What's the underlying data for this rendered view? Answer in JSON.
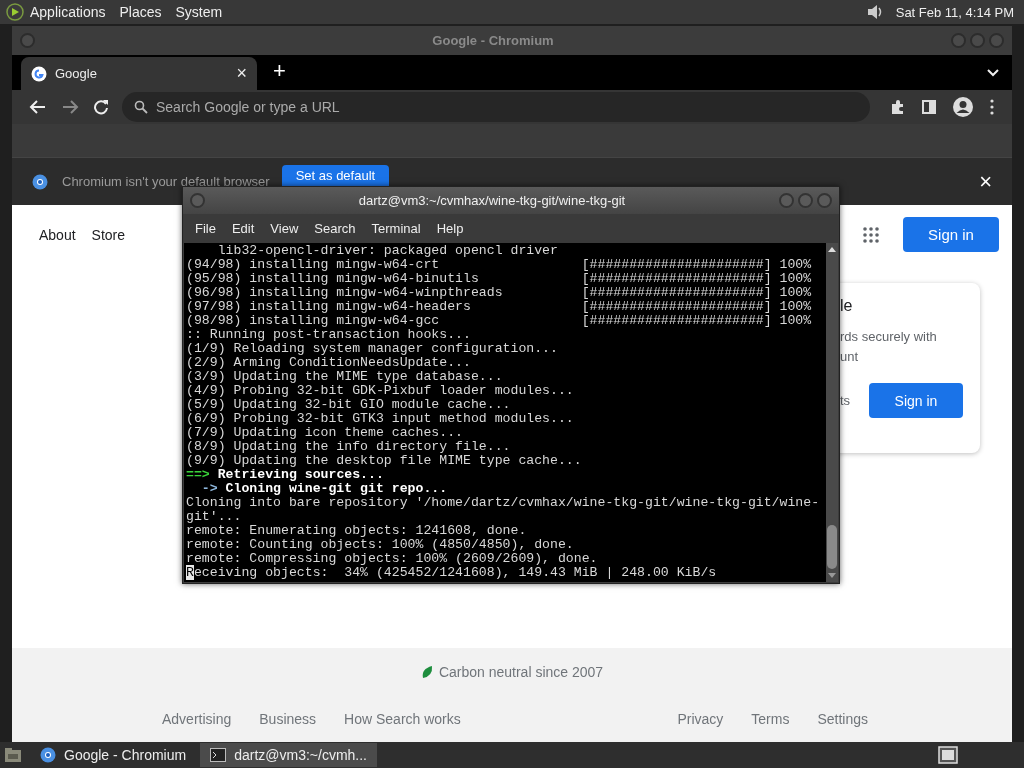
{
  "top_panel": {
    "menus": [
      "Applications",
      "Places",
      "System"
    ],
    "clock": "Sat Feb 11, 4:14 PM"
  },
  "browser": {
    "title": "Google - Chromium",
    "tabs": [
      {
        "label": "Google",
        "close": "×",
        "selected": true
      }
    ],
    "new_tab": "+",
    "address": {
      "placeholder": "Search Google or type a URL"
    },
    "infobar": {
      "message": "Chromium isn't your default browser",
      "button": "Set as default",
      "close": "×"
    },
    "page": {
      "header_links": [
        "About",
        "Store"
      ],
      "sign_in": "Sign in",
      "card": {
        "title": "le",
        "text_lines": [
          "rds securely with",
          "unt"
        ],
        "link": "ts",
        "button": "Sign in"
      },
      "carbon": "Carbon neutral since 2007",
      "footer_left": [
        "Advertising",
        "Business",
        "How Search works"
      ],
      "footer_right": [
        "Privacy",
        "Terms",
        "Settings"
      ]
    }
  },
  "terminal": {
    "title": "dartz@vm3:~/cvmhax/wine-tkg-git/wine-tkg-git",
    "menus": [
      "File",
      "Edit",
      "View",
      "Search",
      "Terminal",
      "Help"
    ],
    "lines": [
      {
        "kind": "plain",
        "text": "    lib32-opencl-driver: packaged opencl driver"
      },
      {
        "kind": "progress",
        "text": "(94/98) installing mingw-w64-crt",
        "bar": "[######################]",
        "percent": "100%"
      },
      {
        "kind": "progress",
        "text": "(95/98) installing mingw-w64-binutils",
        "bar": "[######################]",
        "percent": "100%"
      },
      {
        "kind": "progress",
        "text": "(96/98) installing mingw-w64-winpthreads",
        "bar": "[######################]",
        "percent": "100%"
      },
      {
        "kind": "progress",
        "text": "(97/98) installing mingw-w64-headers",
        "bar": "[######################]",
        "percent": "100%"
      },
      {
        "kind": "progress",
        "text": "(98/98) installing mingw-w64-gcc",
        "bar": "[######################]",
        "percent": "100%"
      },
      {
        "kind": "plain",
        "text": ":: Running post-transaction hooks..."
      },
      {
        "kind": "plain",
        "text": "(1/9) Reloading system manager configuration..."
      },
      {
        "kind": "plain",
        "text": "(2/9) Arming ConditionNeedsUpdate..."
      },
      {
        "kind": "plain",
        "text": "(3/9) Updating the MIME type database..."
      },
      {
        "kind": "plain",
        "text": "(4/9) Probing 32-bit GDK-Pixbuf loader modules..."
      },
      {
        "kind": "plain",
        "text": "(5/9) Updating 32-bit GIO module cache..."
      },
      {
        "kind": "plain",
        "text": "(6/9) Probing 32-bit GTK3 input method modules..."
      },
      {
        "kind": "plain",
        "text": "(7/9) Updating icon theme caches..."
      },
      {
        "kind": "plain",
        "text": "(8/9) Updating the info directory file..."
      },
      {
        "kind": "plain",
        "text": "(9/9) Updating the desktop file MIME type cache..."
      },
      {
        "kind": "step_major",
        "arrow": "==>",
        "text": "Retrieving sources..."
      },
      {
        "kind": "step_minor",
        "arrow": "  ->",
        "text": "Cloning wine-git git repo..."
      },
      {
        "kind": "plain",
        "text": "Cloning into bare repository '/home/dartz/cvmhax/wine-tkg-git/wine-tkg-git/wine-"
      },
      {
        "kind": "plain",
        "text": "git'..."
      },
      {
        "kind": "plain",
        "text": "remote: Enumerating objects: 1241608, done."
      },
      {
        "kind": "plain",
        "text": "remote: Counting objects: 100% (4850/4850), done."
      },
      {
        "kind": "plain",
        "text": "remote: Compressing objects: 100% (2609/2609), done."
      },
      {
        "kind": "plain",
        "text": "Receiving objects:  34% (425452/1241608), 149.43 MiB | 248.00 KiB/s",
        "cursor": true
      }
    ]
  },
  "taskbar": {
    "items": [
      {
        "label": "Google - Chromium",
        "kind": "browser",
        "selected": false
      },
      {
        "label": "dartz@vm3:~/cvmh...",
        "kind": "terminal",
        "selected": true
      }
    ]
  }
}
